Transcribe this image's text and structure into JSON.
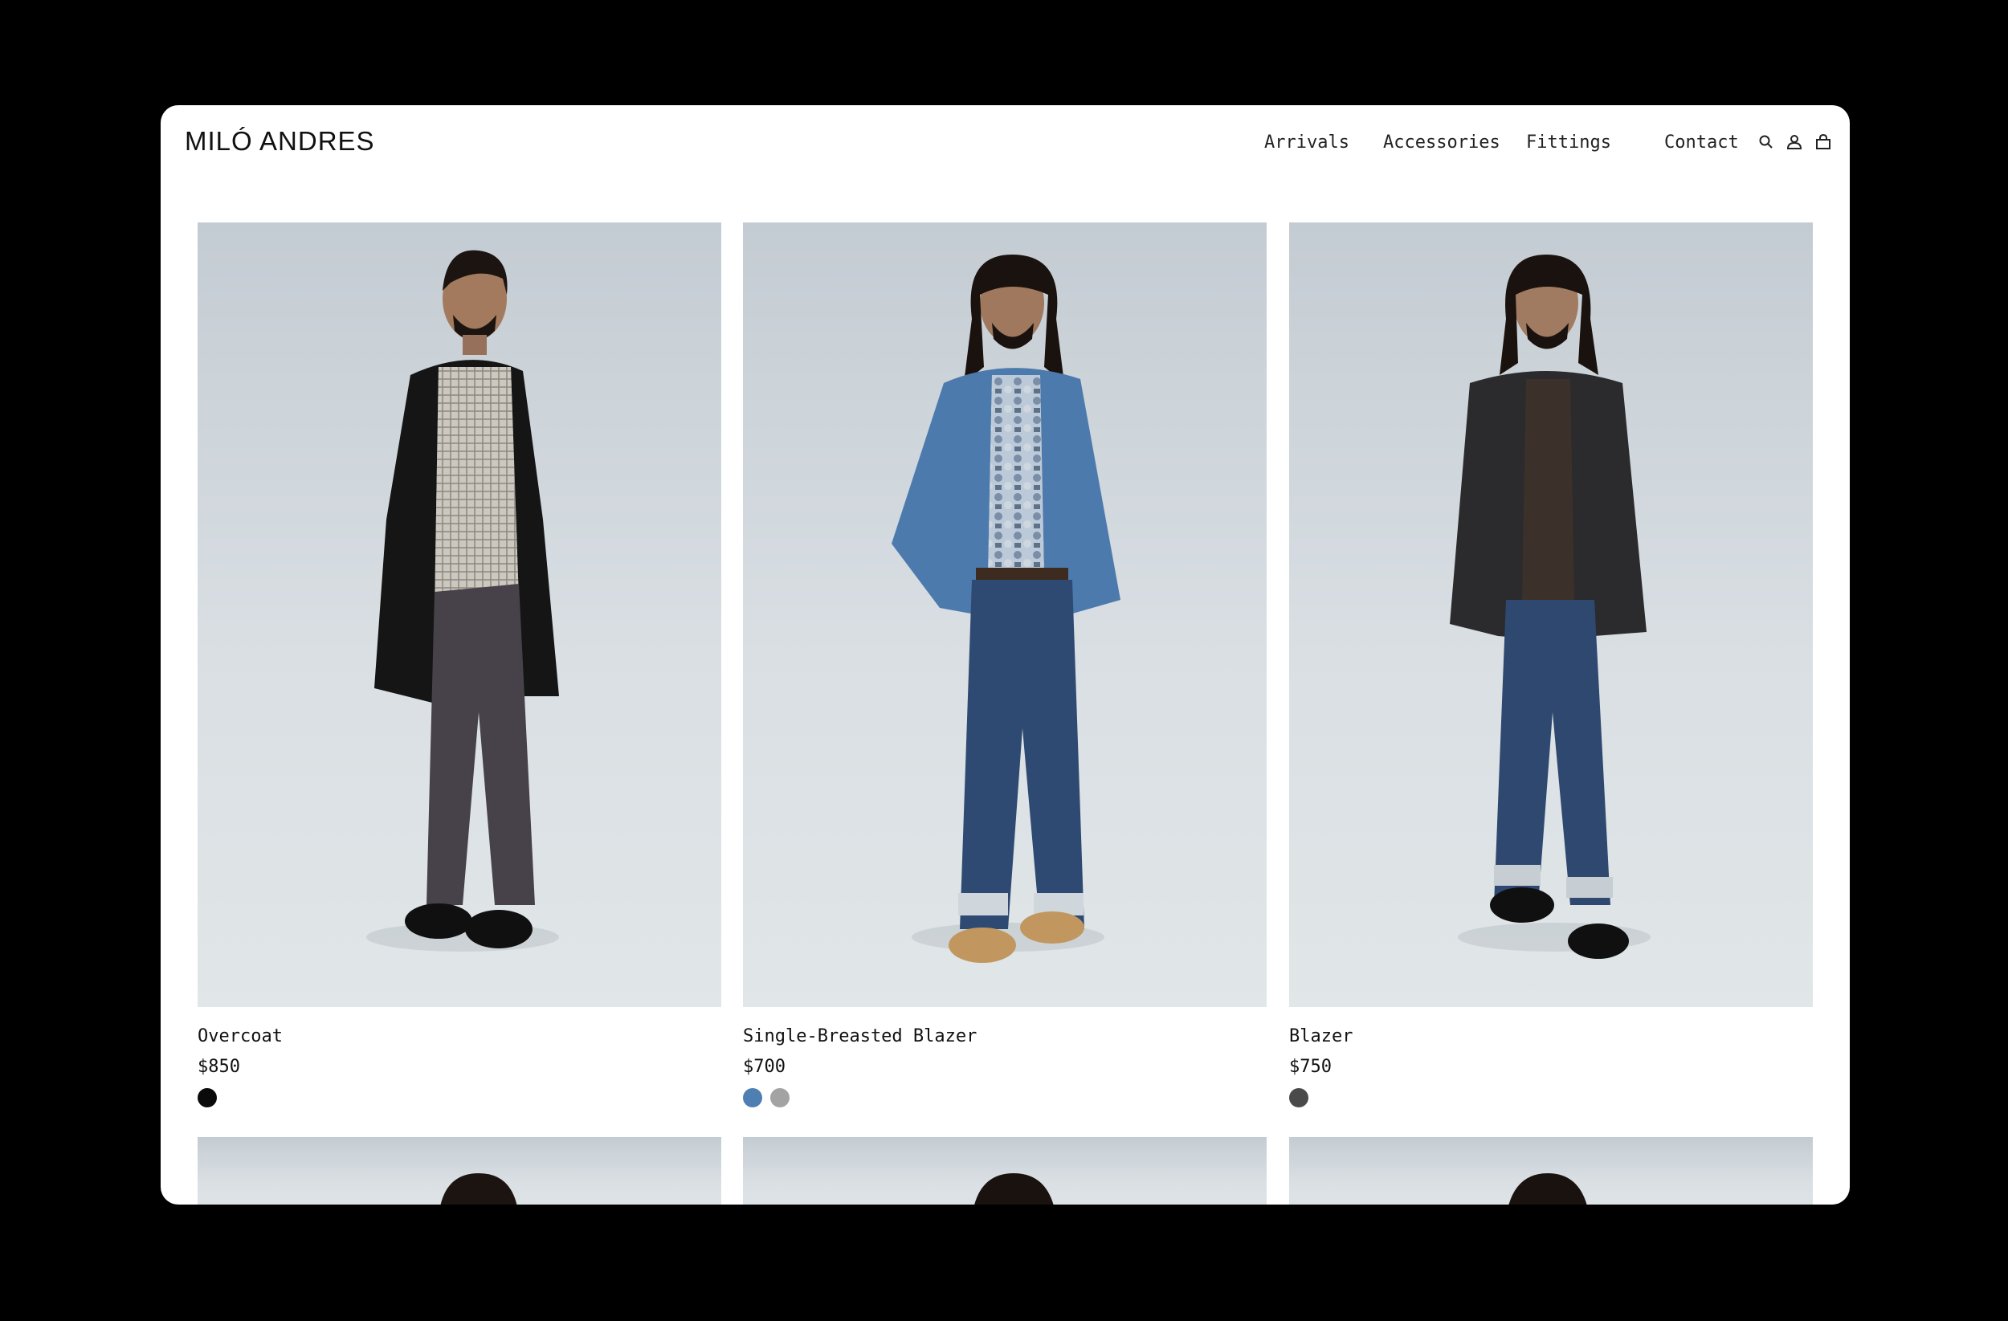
{
  "brand": {
    "logo_text": "MILÓ ANDRES"
  },
  "nav": {
    "links": [
      "Arrivals",
      "Accessories",
      "Fittings",
      "Contact"
    ],
    "icons": [
      "search-icon",
      "account-icon",
      "shopping-bag-icon"
    ]
  },
  "products": [
    {
      "name": "Overcoat",
      "price": "$850",
      "swatches": [
        {
          "color": "#0a0a0a"
        }
      ]
    },
    {
      "name": "Single-Breasted Blazer",
      "price": "$700",
      "swatches": [
        {
          "color": "#4f7fb2"
        },
        {
          "color": "#a3a3a3"
        }
      ]
    },
    {
      "name": "Blazer",
      "price": "$750",
      "swatches": [
        {
          "color": "#4a4a4a"
        }
      ]
    }
  ]
}
